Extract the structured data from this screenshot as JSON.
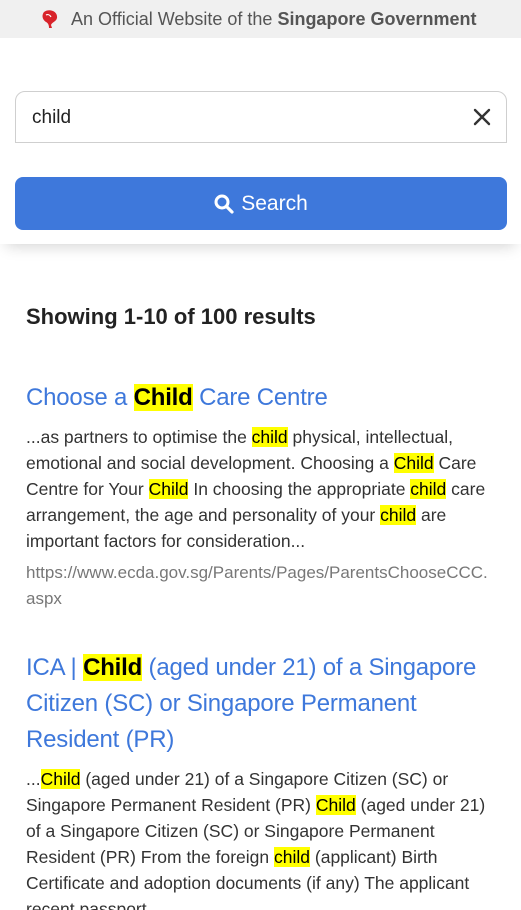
{
  "masthead": {
    "prefix": "An Official Website of the ",
    "strong": "Singapore Government"
  },
  "search": {
    "value": "child",
    "button_label": "Search"
  },
  "results_summary": "Showing 1-10 of 100 results",
  "colors": {
    "accent": "#3e78db",
    "highlight": "#ffff00",
    "masthead_bg": "#f0f0f0",
    "lion_red": "#d8232a"
  },
  "results": [
    {
      "title": [
        {
          "t": "Choose a "
        },
        {
          "t": "Child",
          "hl": true
        },
        {
          "t": " Care Centre"
        }
      ],
      "snippet": [
        {
          "t": "...as partners to optimise the "
        },
        {
          "t": "child",
          "hl": true
        },
        {
          "t": " physical, intellectual, emotional and social development. Choosing a "
        },
        {
          "t": "Child",
          "hl": true
        },
        {
          "t": " Care Centre for Your "
        },
        {
          "t": "Child",
          "hl": true
        },
        {
          "t": " In choosing the appropriate "
        },
        {
          "t": "child",
          "hl": true
        },
        {
          "t": " care arrangement, the age and personality of your "
        },
        {
          "t": "child",
          "hl": true
        },
        {
          "t": " are important factors for consideration..."
        }
      ],
      "url": "https://www.ecda.gov.sg/Parents/Pages/ParentsChooseCCC.aspx"
    },
    {
      "title": [
        {
          "t": "ICA | "
        },
        {
          "t": "Child",
          "hl": true
        },
        {
          "t": " (aged under 21) of a Singapore Citizen (SC) or Singapore Permanent Resident (PR)"
        }
      ],
      "snippet": [
        {
          "t": "..."
        },
        {
          "t": "Child",
          "hl": true
        },
        {
          "t": " (aged under 21) of a Singapore Citizen (SC) or Singapore Permanent Resident (PR) "
        },
        {
          "t": "Child",
          "hl": true
        },
        {
          "t": " (aged under 21) of a Singapore Citizen (SC) or Singapore Permanent Resident (PR) From the foreign "
        },
        {
          "t": "child",
          "hl": true
        },
        {
          "t": " (applicant) Birth Certificate and adoption documents (if any) The applicant recent passport..."
        }
      ],
      "url": ""
    }
  ]
}
